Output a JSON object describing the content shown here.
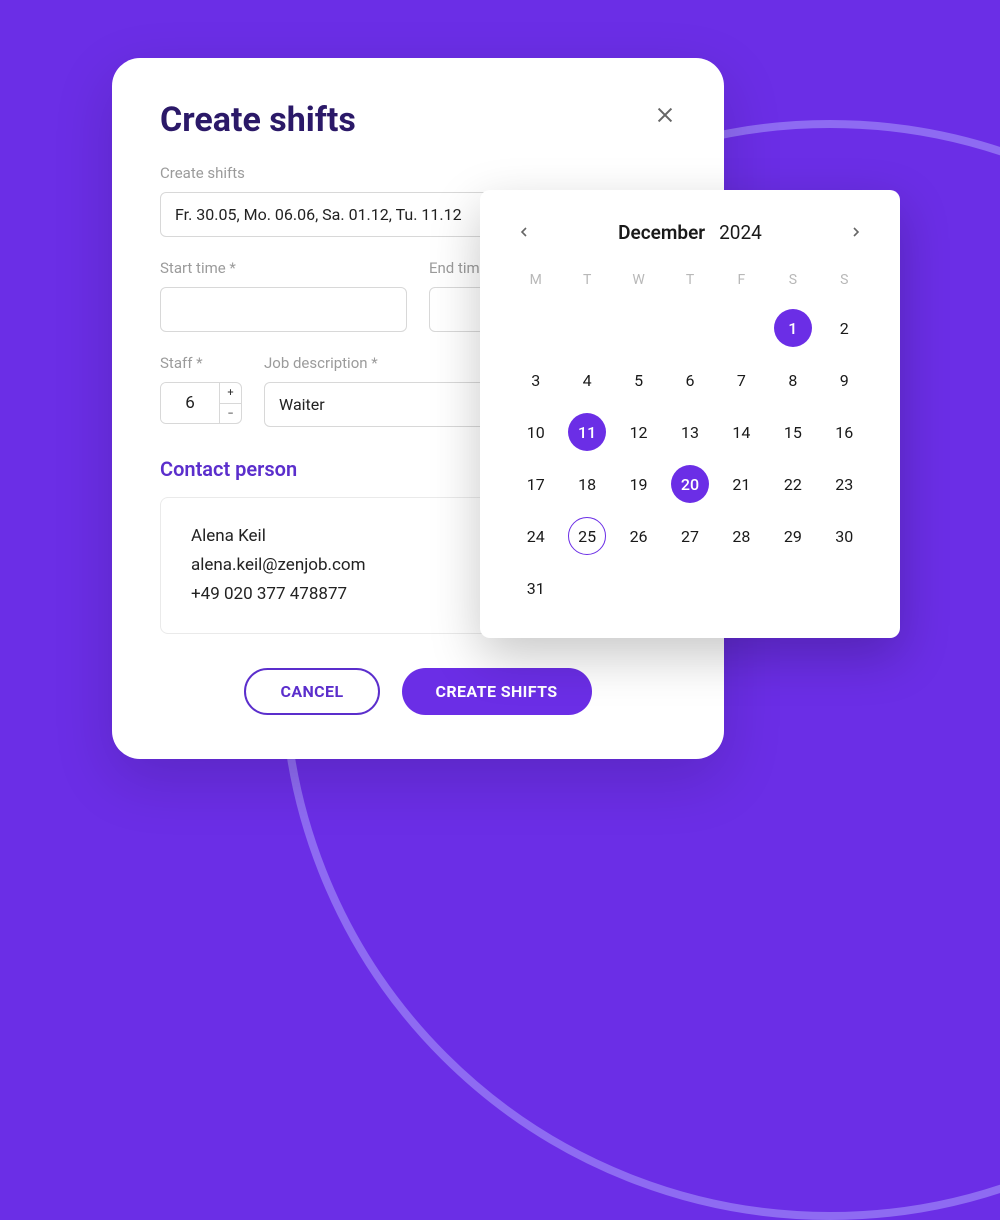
{
  "modal": {
    "title": "Create shifts",
    "dates_label": "Create shifts",
    "dates_value": "Fr. 30.05, Mo. 06.06, Sa. 01.12, Tu. 11.12",
    "start_time_label": "Start time *",
    "start_time_value": "",
    "end_time_label": "End time *",
    "end_time_value": "",
    "staff_label": "Staff *",
    "staff_value": "6",
    "job_label": "Job description *",
    "job_value": "Waiter",
    "contact_header": "Contact person",
    "contact": {
      "name": "Alena Keil",
      "email": "alena.keil@zenjob.com",
      "phone": "+49 020 377 478877"
    },
    "cancel_label": "CANCEL",
    "submit_label": "CREATE SHIFTS"
  },
  "calendar": {
    "month": "December",
    "year": "2024",
    "dow": [
      "M",
      "T",
      "W",
      "T",
      "F",
      "S",
      "S"
    ],
    "leading_blanks": 5,
    "days_in_month": 31,
    "selected": [
      1,
      11,
      20
    ],
    "outlined": [
      25
    ]
  },
  "colors": {
    "accent": "#6B2EE6",
    "heading": "#2B1968"
  }
}
